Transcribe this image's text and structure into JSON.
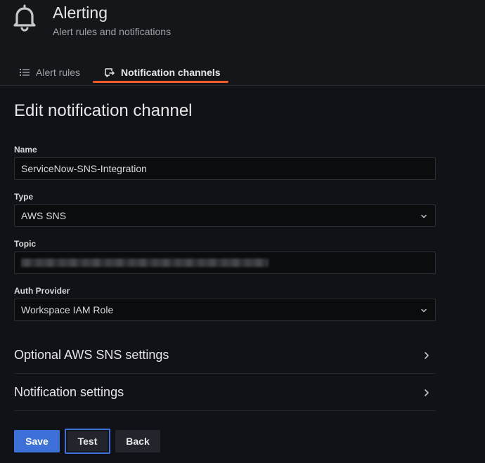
{
  "header": {
    "title": "Alerting",
    "subtitle": "Alert rules and notifications",
    "icon": "bell-icon"
  },
  "tabs": [
    {
      "label": "Alert rules",
      "icon": "list-icon",
      "active": false
    },
    {
      "label": "Notification channels",
      "icon": "comment-alt-share-icon",
      "active": true
    }
  ],
  "form": {
    "title": "Edit notification channel",
    "name": {
      "label": "Name",
      "value": "ServiceNow-SNS-Integration"
    },
    "type": {
      "label": "Type",
      "value": "AWS SNS"
    },
    "topic": {
      "label": "Topic",
      "value_redacted": true
    },
    "auth_provider": {
      "label": "Auth Provider",
      "value": "Workspace IAM Role"
    }
  },
  "sections": [
    {
      "label": "Optional AWS SNS settings",
      "expanded": false
    },
    {
      "label": "Notification settings",
      "expanded": false
    }
  ],
  "buttons": {
    "save": "Save",
    "test": "Test",
    "back": "Back"
  },
  "colors": {
    "accent_tab": "#f05a28",
    "primary_button": "#3d71d9",
    "background": "#111217"
  }
}
